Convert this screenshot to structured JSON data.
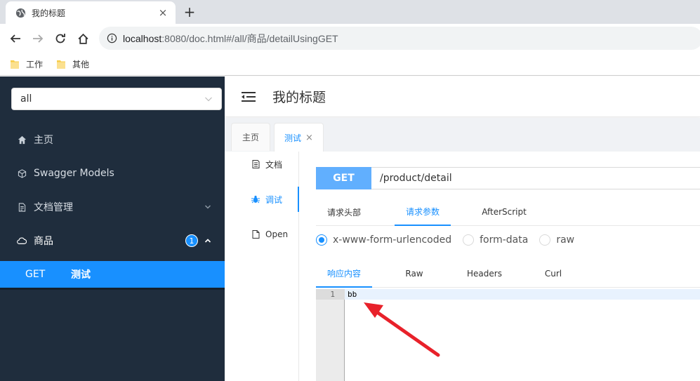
{
  "browser": {
    "tab_title": "我的标题",
    "tab_close": "×",
    "new_tab": "+",
    "url_host": "localhost",
    "url_rest": ":8080/doc.html#/all/商品/detailUsingGET",
    "bookmarks": [
      "工作",
      "其他"
    ]
  },
  "sidebar": {
    "group_select": "all",
    "items": [
      {
        "label": "主页",
        "icon": "home-icon"
      },
      {
        "label": "Swagger Models",
        "icon": "cube-icon"
      },
      {
        "label": "文档管理",
        "icon": "document-icon"
      },
      {
        "label": "商品",
        "icon": "cloud-icon",
        "badge": "1"
      }
    ],
    "submenu": {
      "method": "GET",
      "name": "测试"
    }
  },
  "header": {
    "title": "我的标题"
  },
  "page_tabs": [
    {
      "label": "主页"
    },
    {
      "label": "测试",
      "close": "×"
    }
  ],
  "vertical_tabs": [
    {
      "label": "文档",
      "icon": "document-icon"
    },
    {
      "label": "调试",
      "icon": "bug-icon"
    },
    {
      "label": "Open",
      "icon": "file-icon"
    }
  ],
  "api": {
    "method": "GET",
    "path": "/product/detail"
  },
  "request_tabs": [
    "请求头部",
    "请求参数",
    "AfterScript"
  ],
  "content_types": [
    "x-www-form-urlencoded",
    "form-data",
    "raw"
  ],
  "response_tabs": [
    "响应内容",
    "Raw",
    "Headers",
    "Curl"
  ],
  "editor": {
    "line_number": "1",
    "content": "bb"
  },
  "colors": {
    "sidebar_bg": "#1f2d3d",
    "accent": "#1890ff",
    "get_method": "#61affe",
    "annotation_arrow": "#e8212a"
  }
}
